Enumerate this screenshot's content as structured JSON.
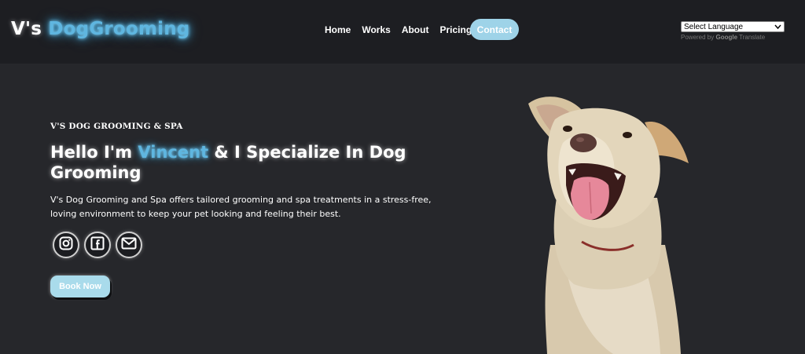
{
  "header": {
    "logo_prefix": "V's",
    "logo_highlight": "DogGrooming",
    "nav": [
      "Home",
      "Works",
      "About",
      "Pricing"
    ],
    "contact_label": "Contact",
    "language": {
      "selected": "Select Language",
      "powered_by": "Powered by",
      "google": "Google",
      "translate": "Translate"
    }
  },
  "hero": {
    "kicker": "V'S DOG GROOMING & SPA",
    "headline_before": "Hello I'm",
    "headline_name": "Vincent",
    "headline_after": "& I Specialize In Dog Grooming",
    "description": "V's Dog Grooming and Spa offers tailored grooming and spa treatments in a stress-free, loving environment to keep your pet looking and feeling their best.",
    "socials": [
      "instagram-icon",
      "facebook-icon",
      "mail-icon"
    ],
    "book_label": "Book Now"
  },
  "colors": {
    "background": "#26272b",
    "navbar": "#1d1e22",
    "accent": "#5fb6e0",
    "button": "#9ed3e8"
  }
}
